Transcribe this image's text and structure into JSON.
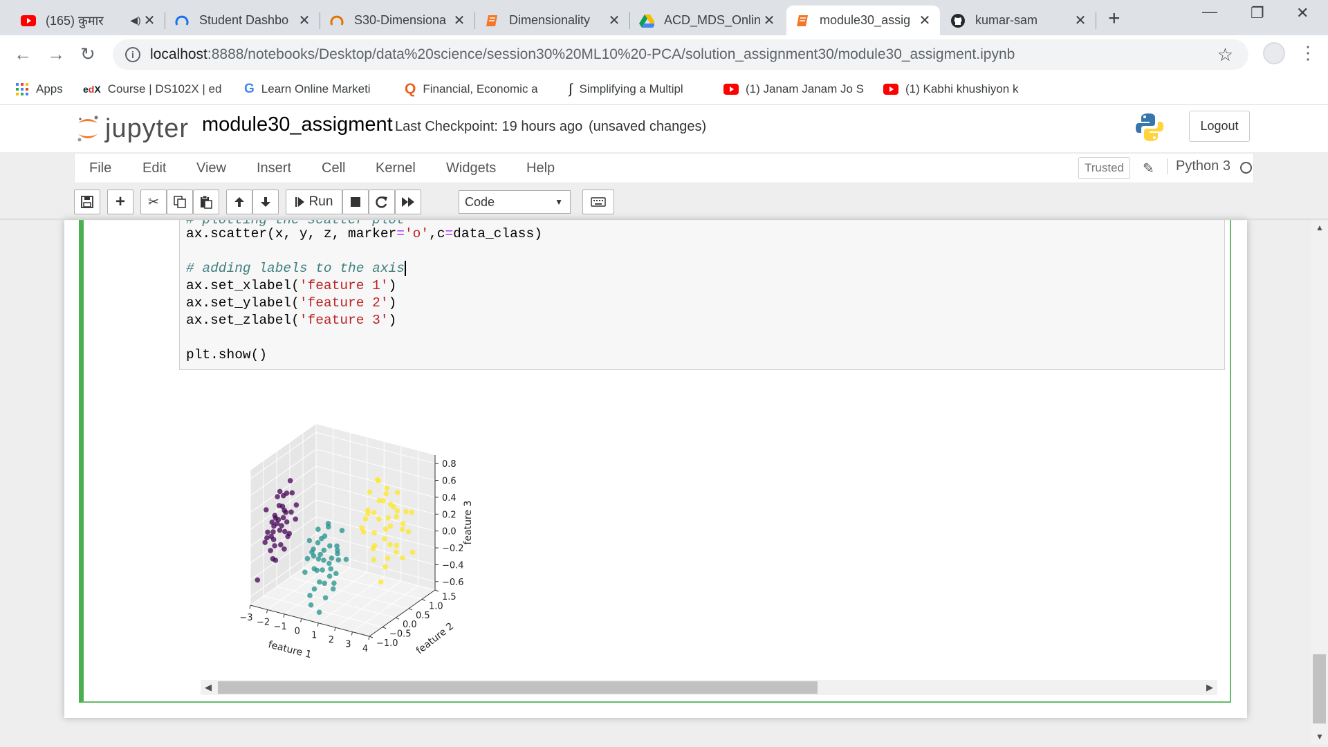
{
  "tabs": [
    {
      "title": "(165) कुमार",
      "icon": "youtube-icon",
      "audio": true
    },
    {
      "title": "Student Dashbo",
      "icon": "loading-icon"
    },
    {
      "title": "S30-Dimensiona",
      "icon": "loading-icon"
    },
    {
      "title": "Dimensionality",
      "icon": "jupyter-notebook-icon"
    },
    {
      "title": "ACD_MDS_Onlin",
      "icon": "google-drive-icon"
    },
    {
      "title": "module30_assig",
      "icon": "jupyter-notebook-icon",
      "active": true
    },
    {
      "title": "kumar-sam",
      "icon": "github-icon"
    }
  ],
  "address": {
    "host": "localhost",
    "rest": ":8888/notebooks/Desktop/data%20science/session30%20ML10%20-PCA/solution_assignment30/module30_assigment.ipynb"
  },
  "bookmarks": [
    {
      "label": "Apps",
      "icon": "apps-grid-icon"
    },
    {
      "label": "Course | DS102X | ed",
      "icon": "edx-icon"
    },
    {
      "label": "Learn Online Marketi",
      "icon": "google-icon"
    },
    {
      "label": "Financial, Economic a",
      "icon": "q-icon"
    },
    {
      "label": "Simplifying a Multipl",
      "icon": "integral-icon"
    },
    {
      "label": "(1) Janam Janam Jo S",
      "icon": "youtube-icon"
    },
    {
      "label": "(1) Kabhi khushiyon k",
      "icon": "youtube-icon"
    }
  ],
  "jupyter": {
    "logo_text": "jupyter",
    "notebook_name": "module30_assigment",
    "checkpoint": "Last Checkpoint: 19 hours ago",
    "unsaved": "(unsaved changes)",
    "logout": "Logout",
    "menu": [
      "File",
      "Edit",
      "View",
      "Insert",
      "Cell",
      "Kernel",
      "Widgets",
      "Help"
    ],
    "trusted": "Trusted",
    "kernel": "Python 3",
    "run_label": "Run",
    "cell_type": "Code"
  },
  "code": {
    "partial_comment": "# plotting the scatter plot",
    "scatter_call": {
      "pre": "ax.scatter(x, y, z, marker",
      "eq1": "=",
      "str1": "'o'",
      "mid": ",c",
      "eq2": "=",
      "post": "data_class)"
    },
    "comment_labels": "# adding labels to the axis",
    "xlabel": {
      "pre": "ax.set_xlabel(",
      "str": "'feature 1'",
      "post": ")"
    },
    "ylabel": {
      "pre": "ax.set_ylabel(",
      "str": "'feature 2'",
      "post": ")"
    },
    "zlabel": {
      "pre": "ax.set_zlabel(",
      "str": "'feature 3'",
      "post": ")"
    },
    "show": "plt.show()"
  },
  "chart_data": {
    "type": "scatter",
    "projection": "3d",
    "xlabel": "feature 1",
    "ylabel": "feature 2",
    "zlabel": "feature 3",
    "xticks": [
      "−3",
      "−2",
      "−1",
      "0",
      "1",
      "2",
      "3",
      "4"
    ],
    "yticks": [
      "−1.0",
      "−0.5",
      "0.0",
      "0.5",
      "1.0",
      "1.5"
    ],
    "zticks": [
      "−0.6",
      "−0.4",
      "−0.2",
      "0.0",
      "0.2",
      "0.4",
      "0.6",
      "0.8"
    ],
    "xlim": [
      -3,
      4
    ],
    "ylim": [
      -1.0,
      1.5
    ],
    "zlim": [
      -0.7,
      0.9
    ],
    "colors": {
      "class0": "#440154",
      "class1": "#21918c",
      "class2": "#fde725"
    },
    "series": [
      {
        "class": 0,
        "points": [
          [
            -2.6,
            -0.3,
            0.2
          ],
          [
            -2.4,
            -0.2,
            0.1
          ],
          [
            -2.7,
            -0.4,
            0.0
          ],
          [
            -2.5,
            -0.1,
            0.3
          ],
          [
            -2.3,
            -0.3,
            -0.1
          ],
          [
            -2.8,
            -0.2,
            0.2
          ],
          [
            -2.2,
            -0.4,
            0.1
          ],
          [
            -2.6,
            0.0,
            0.4
          ],
          [
            -2.9,
            -0.3,
            -0.2
          ],
          [
            -2.4,
            -0.5,
            0.0
          ],
          [
            -2.1,
            -0.2,
            0.5
          ],
          [
            -2.7,
            -0.1,
            0.3
          ],
          [
            -2.5,
            -0.4,
            -0.1
          ],
          [
            -2.3,
            0.1,
            0.2
          ],
          [
            -2.6,
            -0.6,
            0.1
          ],
          [
            -2.2,
            0.0,
            0.6
          ],
          [
            -2.8,
            -0.5,
            0.0
          ],
          [
            -2.4,
            0.2,
            0.4
          ],
          [
            -2.0,
            -0.3,
            0.3
          ],
          [
            -2.9,
            0.0,
            0.1
          ],
          [
            -2.5,
            -0.2,
            0.5
          ],
          [
            -2.3,
            -0.6,
            -0.2
          ],
          [
            -2.7,
            0.1,
            0.2
          ],
          [
            -2.1,
            -0.1,
            0.0
          ],
          [
            -2.6,
            -0.3,
            -0.3
          ],
          [
            -2.4,
            0.0,
            0.1
          ],
          [
            -3.0,
            -0.4,
            0.3
          ],
          [
            -2.2,
            -0.5,
            0.2
          ],
          [
            -2.5,
            0.1,
            -0.1
          ],
          [
            -2.8,
            -0.1,
            0.4
          ],
          [
            -2.6,
            -0.7,
            0.0
          ],
          [
            -2.3,
            -0.2,
            0.2
          ],
          [
            -1.9,
            -0.4,
            0.1
          ],
          [
            -2.7,
            -0.3,
            0.1
          ],
          [
            -2.4,
            -0.1,
            -0.2
          ],
          [
            -2.0,
            0.1,
            0.3
          ],
          [
            -2.9,
            -0.2,
            0.0
          ],
          [
            -2.5,
            -0.5,
            0.2
          ],
          [
            -3.2,
            -0.6,
            -0.5
          ],
          [
            -2.2,
            0.2,
            0.1
          ]
        ]
      },
      {
        "class": 1,
        "points": [
          [
            0.5,
            -0.6,
            0.0
          ],
          [
            0.8,
            -0.4,
            -0.2
          ],
          [
            0.2,
            -0.5,
            0.1
          ],
          [
            1.1,
            -0.3,
            -0.1
          ],
          [
            0.6,
            -0.7,
            -0.3
          ],
          [
            0.0,
            -0.6,
            0.0
          ],
          [
            0.9,
            -0.5,
            0.1
          ],
          [
            0.4,
            -0.2,
            -0.2
          ],
          [
            1.3,
            -0.6,
            -0.3
          ],
          [
            -0.2,
            -0.4,
            -0.1
          ],
          [
            0.7,
            -0.8,
            0.0
          ],
          [
            1.0,
            -0.1,
            0.2
          ],
          [
            0.3,
            -0.7,
            -0.4
          ],
          [
            0.5,
            -0.3,
            0.3
          ],
          [
            1.2,
            -0.4,
            0.0
          ],
          [
            -0.1,
            -0.8,
            -0.2
          ],
          [
            0.8,
            -0.6,
            -0.5
          ],
          [
            0.1,
            -0.3,
            0.1
          ],
          [
            1.4,
            -0.2,
            -0.1
          ],
          [
            0.6,
            -0.5,
            0.2
          ],
          [
            0.9,
            -0.7,
            -0.3
          ],
          [
            0.2,
            -0.9,
            0.0
          ],
          [
            1.1,
            -0.5,
            -0.4
          ],
          [
            0.4,
            -0.4,
            0.0
          ],
          [
            0.0,
            -0.2,
            -0.3
          ],
          [
            0.7,
            -0.3,
            -0.1
          ],
          [
            1.5,
            -0.6,
            0.1
          ],
          [
            0.3,
            -0.6,
            -0.2
          ],
          [
            0.9,
            -0.9,
            -0.6
          ],
          [
            -0.3,
            -0.5,
            0.1
          ],
          [
            0.5,
            -1.0,
            -0.4
          ],
          [
            1.0,
            -0.8,
            0.0
          ],
          [
            0.2,
            -0.1,
            0.2
          ],
          [
            0.8,
            -0.2,
            -0.3
          ],
          [
            0.6,
            -0.9,
            -0.1
          ],
          [
            0.1,
            -0.7,
            -0.6
          ],
          [
            1.2,
            -0.7,
            -0.2
          ],
          [
            0.4,
            -0.8,
            0.1
          ],
          [
            0.7,
            -0.1,
            0.0
          ],
          [
            -0.1,
            -0.3,
            0.2
          ]
        ]
      },
      {
        "class": 2,
        "points": [
          [
            1.8,
            0.6,
            0.3
          ],
          [
            2.2,
            0.8,
            0.5
          ],
          [
            1.5,
            0.4,
            0.1
          ],
          [
            2.5,
            1.0,
            0.2
          ],
          [
            1.9,
            0.5,
            -0.1
          ],
          [
            2.8,
            0.7,
            0.4
          ],
          [
            1.6,
            0.9,
            0.6
          ],
          [
            2.3,
            0.3,
            0.0
          ],
          [
            2.0,
            1.1,
            0.3
          ],
          [
            3.0,
            0.9,
            0.1
          ],
          [
            1.7,
            0.2,
            0.2
          ],
          [
            2.6,
            0.6,
            -0.2
          ],
          [
            2.1,
            1.3,
            0.4
          ],
          [
            1.4,
            0.7,
            0.5
          ],
          [
            2.9,
            1.2,
            0.0
          ],
          [
            2.4,
            0.4,
            0.3
          ],
          [
            1.8,
            1.0,
            -0.1
          ],
          [
            3.2,
            0.8,
            0.2
          ],
          [
            2.0,
            0.6,
            0.7
          ],
          [
            2.7,
            1.1,
            -0.3
          ],
          [
            1.6,
            0.5,
            0.3
          ],
          [
            2.3,
            0.9,
            0.1
          ],
          [
            3.4,
            1.0,
            0.3
          ],
          [
            1.9,
            0.3,
            0.4
          ],
          [
            2.5,
            0.5,
            0.5
          ],
          [
            2.2,
            1.2,
            -0.2
          ],
          [
            1.5,
            0.8,
            0.0
          ],
          [
            2.8,
            0.4,
            0.2
          ],
          [
            2.0,
            0.9,
            -0.4
          ],
          [
            3.1,
            0.6,
            -0.1
          ],
          [
            1.7,
            1.2,
            0.1
          ],
          [
            2.4,
            0.7,
            0.6
          ],
          [
            2.6,
            1.3,
            0.2
          ],
          [
            1.3,
            0.6,
            0.2
          ],
          [
            2.1,
            0.4,
            -0.2
          ],
          [
            3.3,
            1.1,
            -0.2
          ],
          [
            2.9,
            0.5,
            0.0
          ],
          [
            1.8,
            0.8,
            0.4
          ],
          [
            2.2,
            0.6,
            -0.5
          ],
          [
            2.7,
            0.9,
            0.3
          ]
        ]
      }
    ]
  }
}
